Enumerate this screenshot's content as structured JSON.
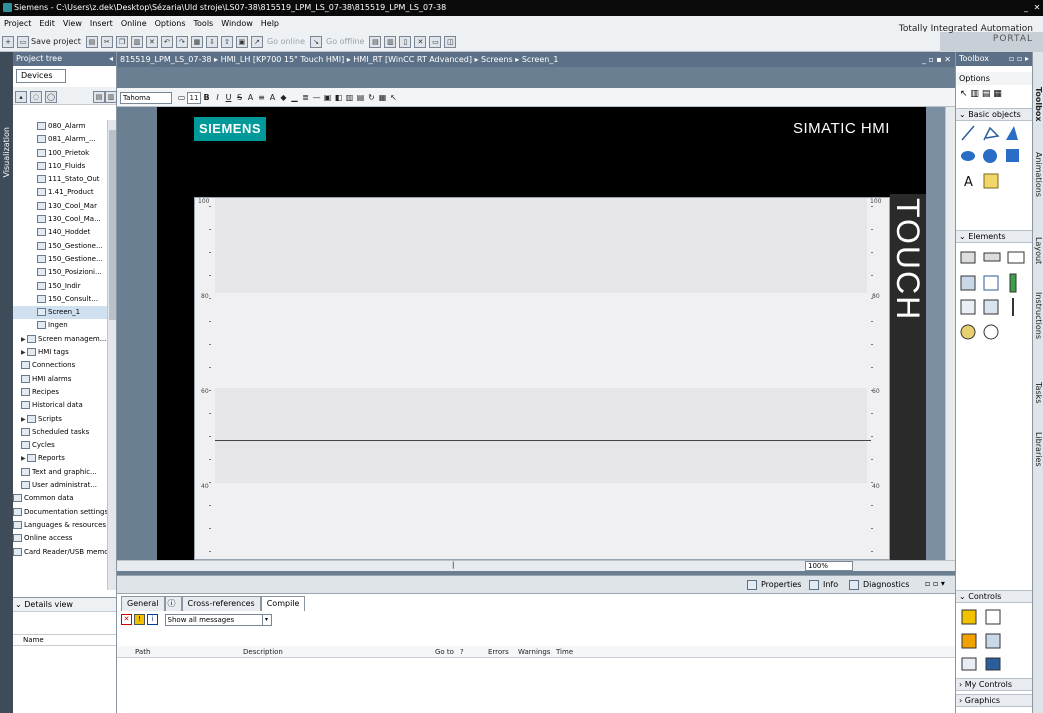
{
  "window": {
    "title": "Siemens - C:\\Users\\z.dek\\Desktop\\Sézaria\\Uld stroje\\LS07-38\\815519_LPM_LS_07-38\\815519_LPM_LS_07-38"
  },
  "menu": [
    "Project",
    "Edit",
    "View",
    "Insert",
    "Online",
    "Options",
    "Tools",
    "Window",
    "Help"
  ],
  "brand": {
    "line1": "Totally Integrated Automation",
    "line2": "PORTAL"
  },
  "toolbar": {
    "save_label": "Save project",
    "go_online": "Go online",
    "go_offline": "Go offline"
  },
  "left_strip": {
    "label": "Visualization"
  },
  "project_tree": {
    "title": "Project tree",
    "devices_tab": "Devices",
    "items": [
      {
        "label": "080_Alarm",
        "indent": 2
      },
      {
        "label": "081_Alarm_...",
        "indent": 2
      },
      {
        "label": "100_Prietok",
        "indent": 2
      },
      {
        "label": "110_Fluids",
        "indent": 2
      },
      {
        "label": "111_Stato_Out",
        "indent": 2
      },
      {
        "label": "1.41_Product",
        "indent": 2
      },
      {
        "label": "130_Cool_Mar",
        "indent": 2
      },
      {
        "label": "130_Cool_Ma...",
        "indent": 2
      },
      {
        "label": "140_Hoddet",
        "indent": 2
      },
      {
        "label": "150_Gestione...",
        "indent": 2
      },
      {
        "label": "150_Gestione...",
        "indent": 2
      },
      {
        "label": "150_Posizioni...",
        "indent": 2
      },
      {
        "label": "150_Indir",
        "indent": 2
      },
      {
        "label": "150_Consult...",
        "indent": 2
      },
      {
        "label": "Screen_1",
        "indent": 2,
        "selected": true
      },
      {
        "label": "Ingen",
        "indent": 2
      },
      {
        "label": "Screen managem...",
        "indent": 1,
        "expander": "▶"
      },
      {
        "label": "HMI tags",
        "indent": 1,
        "expander": "▶"
      },
      {
        "label": "Connections",
        "indent": 1
      },
      {
        "label": "HMI alarms",
        "indent": 1
      },
      {
        "label": "Recipes",
        "indent": 1
      },
      {
        "label": "Historical data",
        "indent": 1
      },
      {
        "label": "Scripts",
        "indent": 1,
        "expander": "▶"
      },
      {
        "label": "Scheduled tasks",
        "indent": 1
      },
      {
        "label": "Cycles",
        "indent": 1
      },
      {
        "label": "Reports",
        "indent": 1,
        "expander": "▶"
      },
      {
        "label": "Text and graphic...",
        "indent": 1
      },
      {
        "label": "User administrat...",
        "indent": 1
      },
      {
        "label": "Common data",
        "indent": 0
      },
      {
        "label": "Documentation settings",
        "indent": 0
      },
      {
        "label": "Languages & resources",
        "indent": 0
      },
      {
        "label": "Online access",
        "indent": 0
      },
      {
        "label": "Card Reader/USB memory",
        "indent": 0
      }
    ]
  },
  "details_view": {
    "title": "Details view",
    "name_col": "Name"
  },
  "editor": {
    "breadcrumb": [
      "815519_LPM_LS_07-38",
      "HMI_LH [KP700 15\" Touch HMI]",
      "HMI_RT [WinCC RT Advanced]",
      "Screens",
      "Screen_1"
    ],
    "font": "Tahoma",
    "font_size": "11",
    "zoom": "100%"
  },
  "hmi": {
    "logo": "SIEMENS",
    "product": "SIMATIC HMI",
    "touch": "TOUCH",
    "y_ticks_left": [
      "100",
      "80",
      "60",
      "40"
    ],
    "y_ticks_right": [
      "100",
      "80",
      "60",
      "40"
    ]
  },
  "inspector_bar": {
    "properties": "Properties",
    "info": "Info",
    "diagnostics": "Diagnostics"
  },
  "inspector": {
    "tabs": [
      "General",
      "Cross-references",
      "Compile"
    ],
    "filter": "Show all messages",
    "columns": [
      "Path",
      "Description",
      "Go to",
      "?",
      "Errors",
      "Warnings",
      "Time"
    ]
  },
  "toolbox": {
    "title": "Toolbox",
    "options": "Options",
    "sections": [
      "Basic objects",
      "Elements",
      "Controls",
      "My Controls",
      "Graphics"
    ]
  },
  "right_tabs": [
    "Toolbox",
    "Animations",
    "Layout",
    "Instructions",
    "Tasks",
    "Libraries"
  ]
}
